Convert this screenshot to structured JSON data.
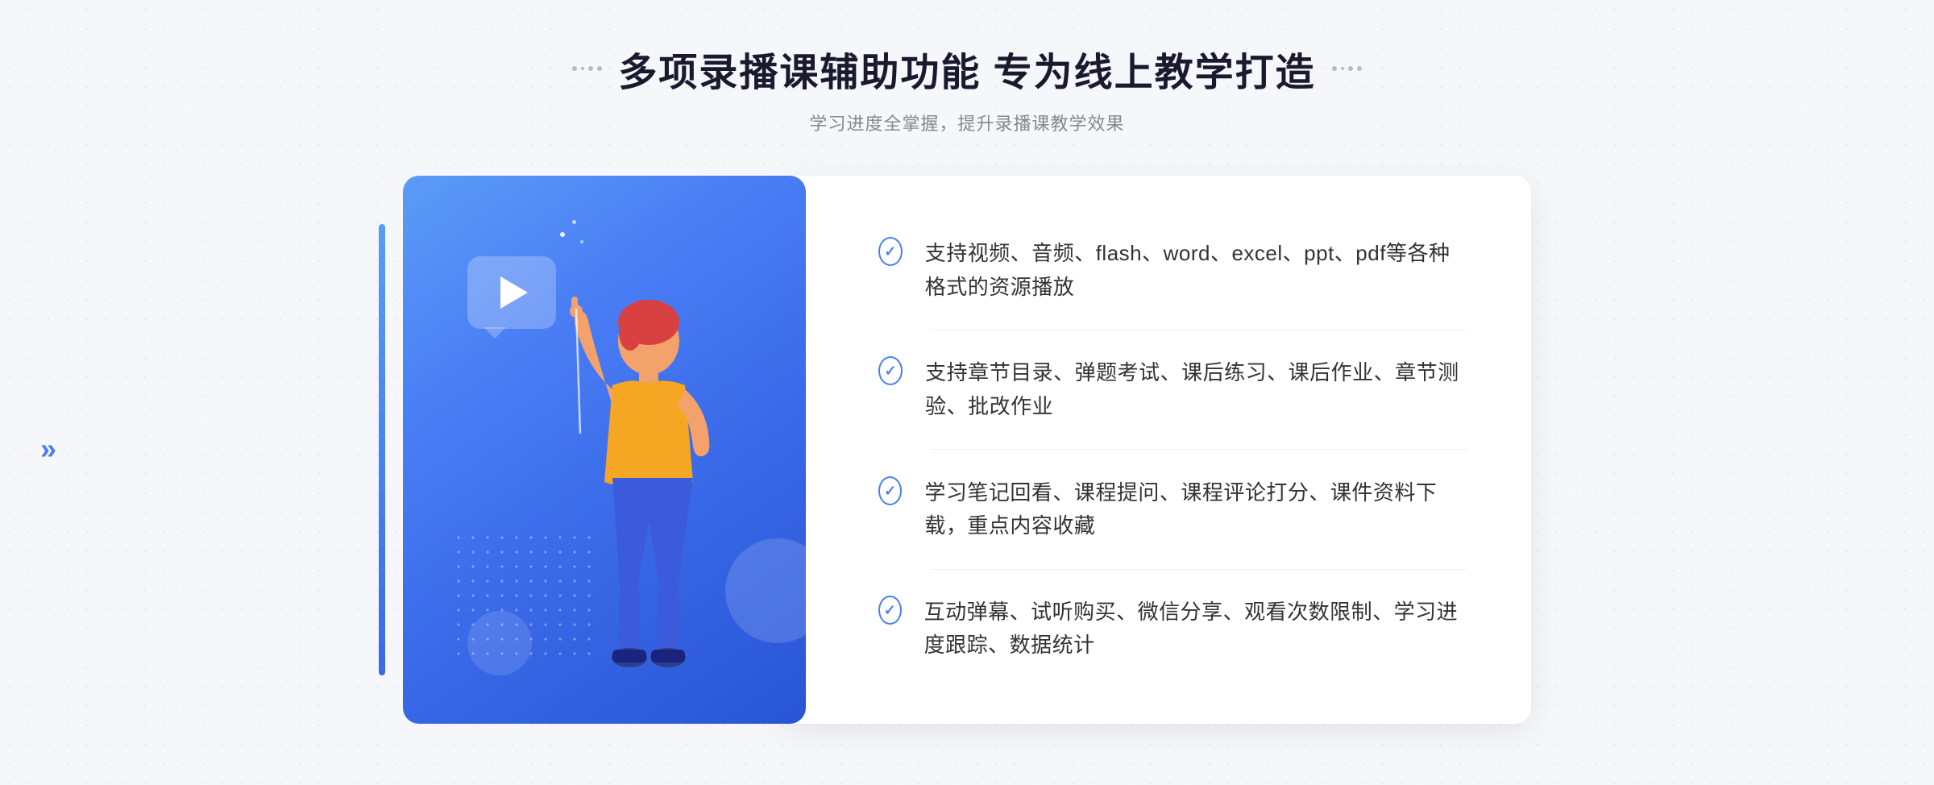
{
  "header": {
    "title": "多项录播课辅助功能 专为线上教学打造",
    "subtitle": "学习进度全掌握，提升录播课教学效果",
    "decorator_dots_left": "··",
    "decorator_dots_right": "··"
  },
  "features": [
    {
      "id": "feature-1",
      "text": "支持视频、音频、flash、word、excel、ppt、pdf等各种格式的资源播放"
    },
    {
      "id": "feature-2",
      "text": "支持章节目录、弹题考试、课后练习、课后作业、章节测验、批改作业"
    },
    {
      "id": "feature-3",
      "text": "学习笔记回看、课程提问、课程评论打分、课件资料下载，重点内容收藏"
    },
    {
      "id": "feature-4",
      "text": "互动弹幕、试听购买、微信分享、观看次数限制、学习进度跟踪、数据统计"
    }
  ],
  "page_left_arrows": "»",
  "colors": {
    "blue_primary": "#4a7ef5",
    "blue_dark": "#2855d6",
    "blue_light": "#5b9cf6",
    "text_dark": "#1a1a2e",
    "text_gray": "#888888",
    "text_body": "#333333",
    "bg_light": "#f5f7fa",
    "white": "#ffffff"
  }
}
